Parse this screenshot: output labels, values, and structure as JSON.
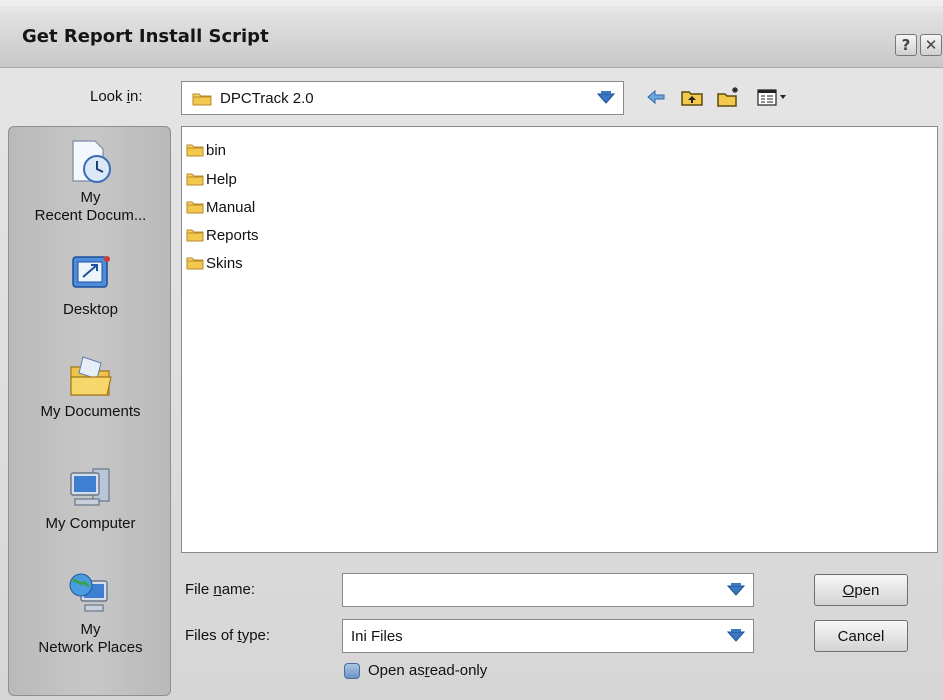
{
  "window": {
    "title": "Get Report Install Script",
    "help_glyph": "?",
    "close_glyph": "✕"
  },
  "lookin": {
    "label_prefix": "Look ",
    "label_accel": "i",
    "label_suffix": "n:",
    "value": "DPCTrack 2.0"
  },
  "places": [
    {
      "label_1": "My",
      "label_2": "Recent Docum...",
      "icon": "recent-documents-icon"
    },
    {
      "label_1": "Desktop",
      "label_2": "",
      "icon": "desktop-icon"
    },
    {
      "label_1": "My Documents",
      "label_2": "",
      "icon": "my-documents-icon"
    },
    {
      "label_1": "My Computer",
      "label_2": "",
      "icon": "my-computer-icon"
    },
    {
      "label_1": "My",
      "label_2": "Network Places",
      "icon": "network-places-icon"
    }
  ],
  "files": [
    {
      "name": "bin"
    },
    {
      "name": "Help"
    },
    {
      "name": "Manual"
    },
    {
      "name": "Reports"
    },
    {
      "name": "Skins"
    }
  ],
  "filename": {
    "label_prefix": "File ",
    "label_accel": "n",
    "label_suffix": "ame:",
    "value": ""
  },
  "filetype": {
    "label_prefix": "Files of ",
    "label_accel": "t",
    "label_suffix": "ype:",
    "value": "Ini Files"
  },
  "readonly": {
    "label_prefix": "Open as ",
    "label_accel": "r",
    "label_suffix": "ead-only",
    "checked": false
  },
  "buttons": {
    "open_accel": "O",
    "open_rest": "pen",
    "cancel": "Cancel"
  },
  "colors": {
    "folder": "#f2c94c",
    "combo_arrow": "#3b78c4",
    "checkbox": "#6c93c6"
  }
}
